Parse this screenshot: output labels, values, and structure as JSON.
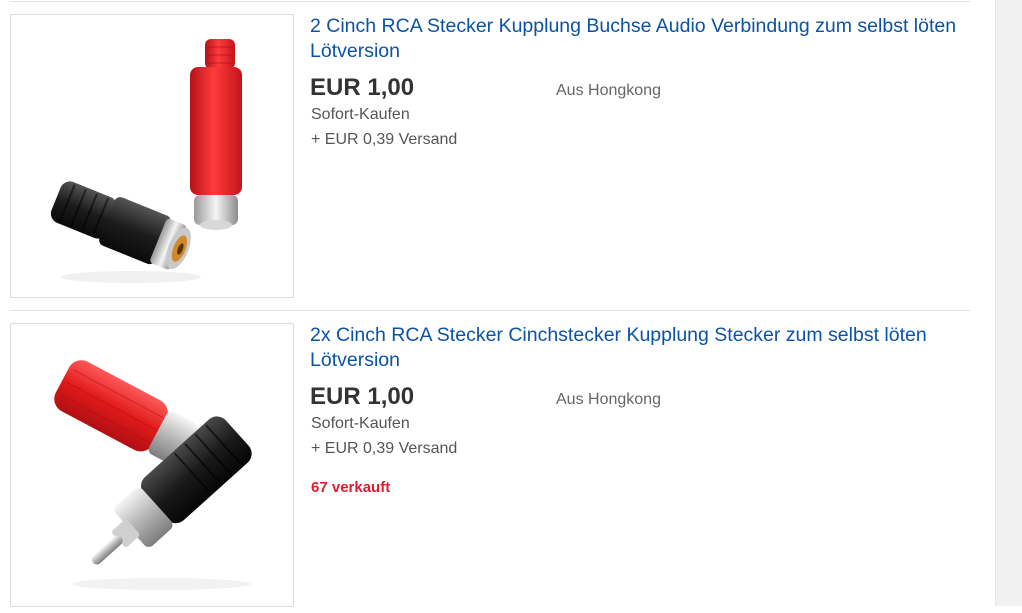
{
  "colors": {
    "link": "#0b53a3",
    "sold": "#dd1e31",
    "price": "#333333",
    "meta": "#555555"
  },
  "listings": [
    {
      "image": "rca-coupling-black-red-image",
      "title": "2 Cinch RCA Stecker Kupplung Buchse Audio Verbindung zum selbst löten Lötversion",
      "price": "EUR 1,00",
      "buy_format": "Sofort-Kaufen",
      "shipping": "+ EUR 0,39 Versand",
      "location": "Aus Hongkong"
    },
    {
      "image": "rca-plug-red-black-image",
      "title": "2x Cinch RCA Stecker Cinchstecker Kupplung Stecker zum selbst löten Lötversion",
      "price": "EUR 1,00",
      "buy_format": "Sofort-Kaufen",
      "shipping": "+ EUR 0,39 Versand",
      "location": "Aus Hongkong",
      "sold": "67 verkauft"
    }
  ]
}
